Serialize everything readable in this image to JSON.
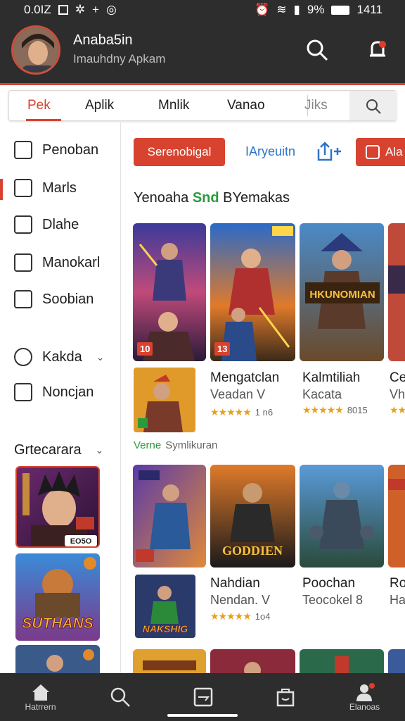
{
  "status_bar": {
    "time_left": "0.0IZ",
    "battery": "9%",
    "clock": "1411"
  },
  "header": {
    "username": "Anaba5in",
    "subtitle": "Imauhdny Apkam"
  },
  "tabs": [
    {
      "label": "Pek",
      "active": true
    },
    {
      "label": "Aplik"
    },
    {
      "label": "Mnlik"
    },
    {
      "label": "Vanao"
    },
    {
      "label": "Jiks"
    }
  ],
  "sidebar": {
    "items": [
      {
        "label": "Penoban"
      },
      {
        "label": "Marls",
        "active": true
      },
      {
        "label": "Dlahe"
      },
      {
        "label": "Manokarl"
      },
      {
        "label": "Soobian"
      },
      {
        "label": "Kakda"
      },
      {
        "label": "Noncjan"
      }
    ],
    "section": "Grtecarara"
  },
  "toolbar": {
    "primary_button": "Serenobigal",
    "link": "IAryeuitn",
    "secondary_button": "Ala"
  },
  "section": {
    "title_prefix": "Yenoaha",
    "title_highlight": "Snd",
    "title_suffix": "BYemakas"
  },
  "games_row1": [
    {
      "badge": "10",
      "title": "Mengatclan",
      "sub": "Veadan V",
      "rating_text": "1 n6",
      "stars": 4
    },
    {
      "badge": "13",
      "title": "Kalmtiliah",
      "sub": "Kacata",
      "rating_text": "8015",
      "stars": 4
    },
    {
      "title": "Ce",
      "sub": "Vh",
      "stars": 4
    }
  ],
  "art_text": {
    "card3": "HKUNOMIAN",
    "card5": "GODDIEN",
    "card7": "NAKSHIG",
    "side2": "SUTHANS",
    "side1_badge": "EO5O"
  },
  "green_label": {
    "label": "Verne",
    "sub": "Symlikuran"
  },
  "games_row2": [
    {
      "title": "Nahdian",
      "sub": "Nendan. V",
      "rating_text": "1o4",
      "stars": 4
    },
    {
      "title": "Poochan",
      "sub": "Teocokel 8"
    },
    {
      "title": "Ro",
      "sub": "Ha"
    }
  ],
  "bottom_nav": [
    {
      "label": "Hatrrern",
      "icon": "home-icon"
    },
    {
      "label": "",
      "icon": "search-icon"
    },
    {
      "label": "",
      "icon": "inbox-icon"
    },
    {
      "label": "",
      "icon": "bag-icon"
    },
    {
      "label": "Elanoas",
      "icon": "profile-icon"
    }
  ],
  "colors": {
    "accent": "#d8432f",
    "dark": "#2e2d2e",
    "green": "#2a9b3d",
    "blue": "#2b74c8"
  }
}
